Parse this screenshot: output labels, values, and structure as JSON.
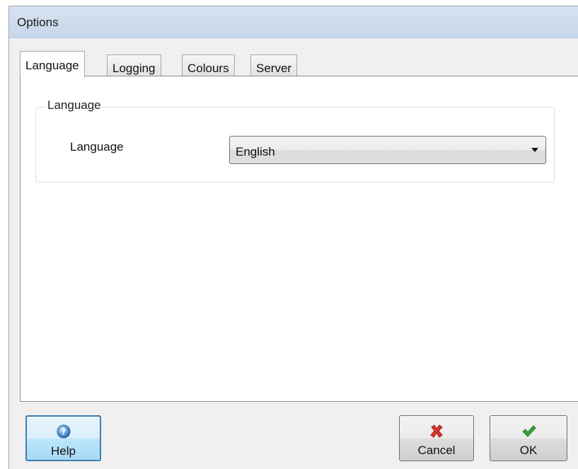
{
  "window": {
    "title": "Options"
  },
  "tabs": [
    {
      "label": "Language",
      "active": true
    },
    {
      "label": "Logging",
      "active": false
    },
    {
      "label": "Colours",
      "active": false
    },
    {
      "label": "Server",
      "active": false
    }
  ],
  "language_group": {
    "legend": "Language",
    "field_label": "Language",
    "selected_value": "English"
  },
  "buttons": {
    "help": {
      "label": "Help",
      "icon": "help-icon"
    },
    "cancel": {
      "label": "Cancel",
      "icon": "cancel-x-icon"
    },
    "ok": {
      "label": "OK",
      "icon": "checkmark-icon"
    }
  },
  "colors": {
    "titlebar": "#d6e2f0",
    "help_accent": "#3c7fb1",
    "cancel_red": "#d9352a",
    "ok_green": "#3aa43a"
  }
}
